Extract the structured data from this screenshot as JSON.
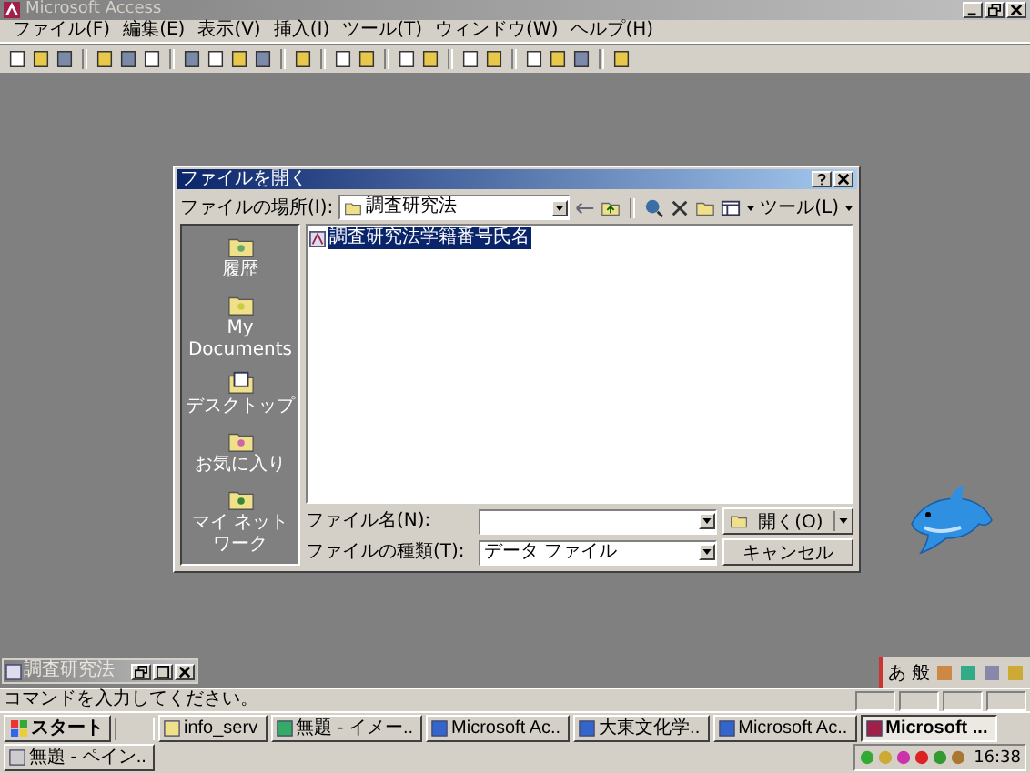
{
  "window": {
    "title": "Microsoft Access",
    "active": false
  },
  "menu": [
    "ファイル(F)",
    "編集(E)",
    "表示(V)",
    "挿入(I)",
    "ツール(T)",
    "ウィンドウ(W)",
    "ヘルプ(H)"
  ],
  "dialog": {
    "title": "ファイルを開く",
    "look_in_label": "ファイルの場所(I):",
    "look_in_value": "調査研究法",
    "tools_menu": "ツール(L)",
    "places": [
      {
        "label": "履歴"
      },
      {
        "label": "My Documents"
      },
      {
        "label": "デスクトップ"
      },
      {
        "label": "お気に入り"
      },
      {
        "label": "マイ ネットワーク"
      }
    ],
    "files": [
      {
        "name": "調査研究法学籍番号氏名",
        "selected": true
      }
    ],
    "filename_label": "ファイル名(N):",
    "filetype_label": "ファイルの種類(T):",
    "filetype_value": "データ ファイル",
    "open_button": "開く(O)",
    "cancel_button": "キャンセル"
  },
  "minimized_window": {
    "title": "調査研究法"
  },
  "status_bar": {
    "text": "コマンドを入力してください。"
  },
  "ime_bar": [
    "あ",
    "般"
  ],
  "taskbar": {
    "start": "スタート",
    "tasks": [
      {
        "label": "info_serv",
        "selected": false
      },
      {
        "label": "無題 - イメー..",
        "selected": false
      },
      {
        "label": "Microsoft Ac..",
        "selected": false
      },
      {
        "label": "大東文化学..",
        "selected": false
      },
      {
        "label": "Microsoft Ac..",
        "selected": false
      },
      {
        "label": "Microsoft ...",
        "selected": true
      },
      {
        "label": "無題 - ペイン..",
        "selected": false
      }
    ],
    "clock": "16:38"
  }
}
